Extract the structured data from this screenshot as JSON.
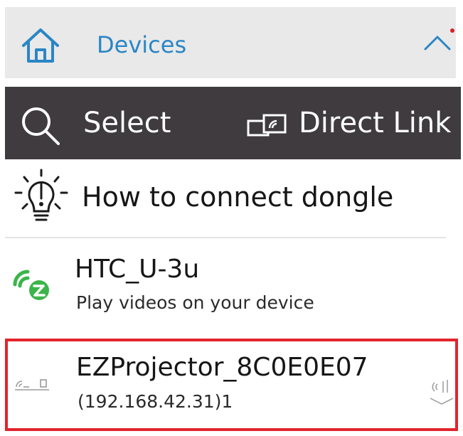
{
  "header": {
    "title": "Devices",
    "icons": {
      "home": "home-icon",
      "collapse": "chevron-up-icon",
      "notification": "notification-dot"
    },
    "accent_color": "#2a86c5",
    "notification_color": "#d81f2a"
  },
  "toolbar": {
    "select_label": "Select",
    "direct_link_label": "Direct Link",
    "icons": {
      "search": "search-icon",
      "direct_link": "direct-link-icon"
    },
    "background_color": "#3f3b3f"
  },
  "help": {
    "label": "How to connect dongle",
    "icon": "lightbulb-icon"
  },
  "devices": [
    {
      "name": "HTC_U-3u",
      "subtitle": "Play videos on your device",
      "icon": "ezcast-icon",
      "icon_color": "#3bb54a"
    },
    {
      "name": "EZProjector_8C0E0E07",
      "subtitle": "(192.168.42.31)1",
      "icon": "projector-icon",
      "selected": true,
      "highlight_color": "#e2242c"
    }
  ]
}
